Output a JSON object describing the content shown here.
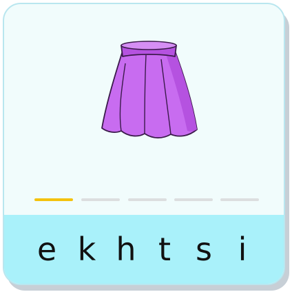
{
  "puzzle": {
    "picture_icon": "skirt-icon",
    "answer_slots": [
      {
        "state": "active"
      },
      {
        "state": "empty"
      },
      {
        "state": "empty"
      },
      {
        "state": "empty"
      },
      {
        "state": "empty"
      }
    ],
    "letters": [
      "e",
      "k",
      "h",
      "t",
      "s",
      "i"
    ]
  },
  "colors": {
    "card_background": "#f1fcfc",
    "tray_background": "#a9f1fa",
    "active_slot": "#f4c20d",
    "empty_slot": "#dcdedf",
    "skirt_fill": "#c86cf0"
  }
}
